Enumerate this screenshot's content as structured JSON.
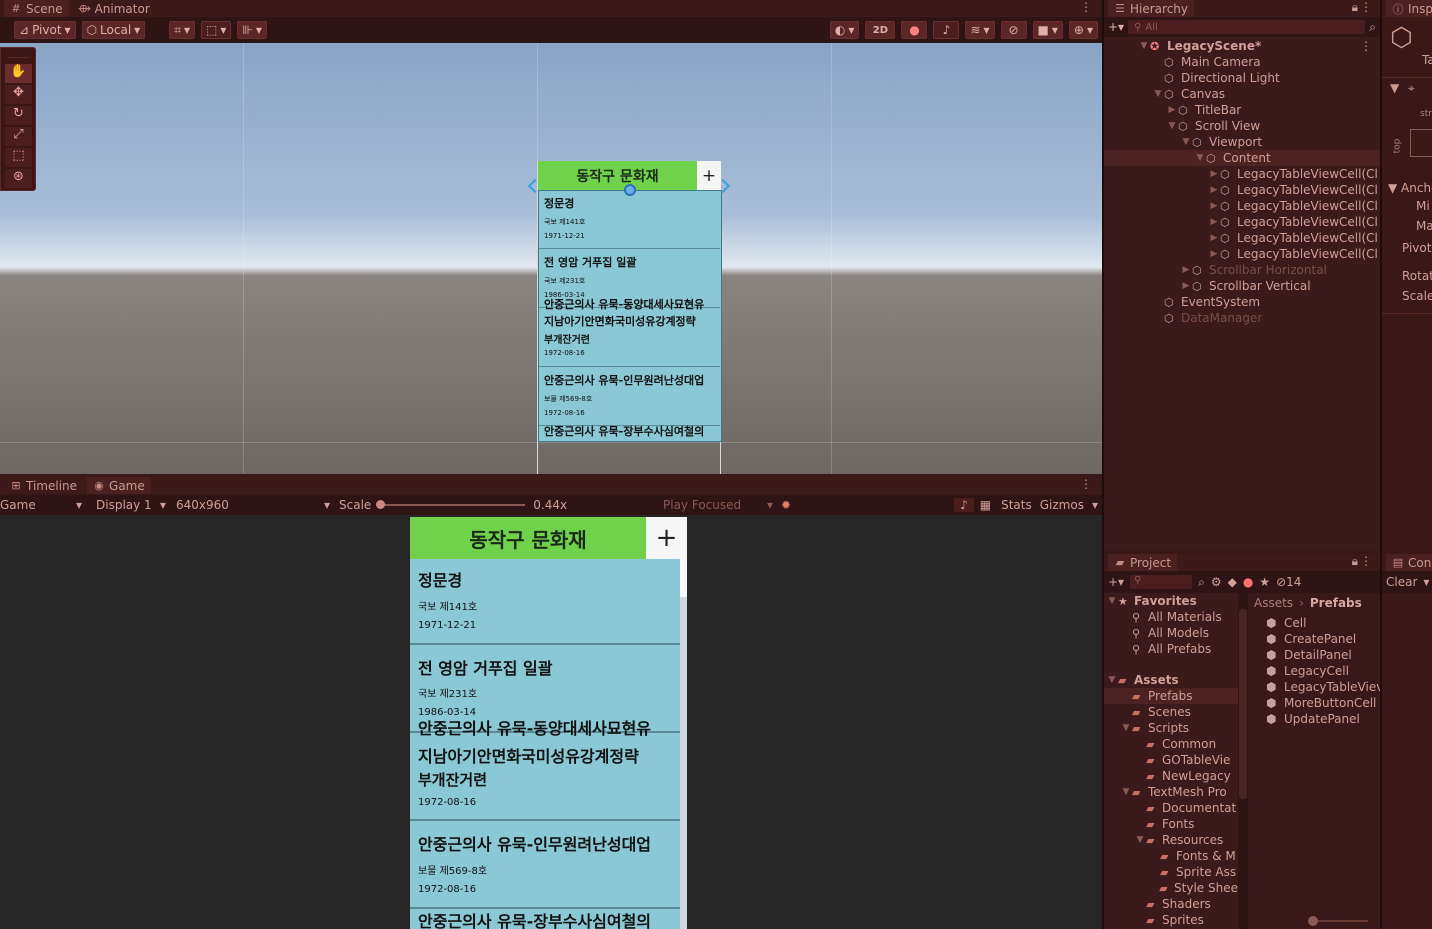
{
  "scene_panel": {
    "tabs": [
      {
        "label": "Scene",
        "icon": "grid-icon"
      },
      {
        "label": "Animator",
        "icon": "animator-icon"
      }
    ],
    "toolbar": {
      "pivot": "Pivot",
      "local": "Local",
      "mode_2d": "2D"
    }
  },
  "scene_view": {
    "title": "동작구 문화재",
    "add": "+",
    "cells": [
      {
        "title": "정문경",
        "sub": "국보 제141호",
        "date": "1971-12-21"
      },
      {
        "title": "전 영암 거푸집 일괄",
        "sub": "국보 제231호",
        "date": "1986-03-14",
        "overflow": "안중근의사 유묵-동양대세사묘현유"
      },
      {
        "title": "지남아기안면화국미성유강계정략",
        "sub": "부개잔거련",
        "date": "1972-08-16"
      },
      {
        "title": "안중근의사 유묵-인무원려난성대업",
        "sub": "보물 제569-8호",
        "date": "1972-08-16"
      },
      {
        "title": "안중근의사 유묵-장부수사심여철의",
        "sub": "",
        "date": ""
      }
    ]
  },
  "game_panel": {
    "tabs": [
      {
        "label": "Timeline",
        "icon": "timeline-icon"
      },
      {
        "label": "Game",
        "icon": "gamepad-icon"
      }
    ],
    "toolbar": {
      "game": "Game",
      "display": "Display 1",
      "resolution": "640x960",
      "scale_label": "Scale",
      "scale_value": "0.44x",
      "play_focused": "Play Focused",
      "stats": "Stats",
      "gizmos": "Gizmos"
    }
  },
  "hierarchy": {
    "tab": "Hierarchy",
    "search_placeholder": "All",
    "items": [
      {
        "label": "LegacyScene*",
        "depth": 0,
        "arrow": "▼",
        "bold": true
      },
      {
        "label": "Main Camera",
        "depth": 1,
        "arrow": ""
      },
      {
        "label": "Directional Light",
        "depth": 1,
        "arrow": ""
      },
      {
        "label": "Canvas",
        "depth": 1,
        "arrow": "▼"
      },
      {
        "label": "TitleBar",
        "depth": 2,
        "arrow": "▶"
      },
      {
        "label": "Scroll View",
        "depth": 2,
        "arrow": "▼"
      },
      {
        "label": "Viewport",
        "depth": 3,
        "arrow": "▼"
      },
      {
        "label": "Content",
        "depth": 4,
        "arrow": "▼",
        "selected": true
      },
      {
        "label": "LegacyTableViewCell(Cl",
        "depth": 5,
        "arrow": "▶"
      },
      {
        "label": "LegacyTableViewCell(Cl",
        "depth": 5,
        "arrow": "▶"
      },
      {
        "label": "LegacyTableViewCell(Cl",
        "depth": 5,
        "arrow": "▶"
      },
      {
        "label": "LegacyTableViewCell(Cl",
        "depth": 5,
        "arrow": "▶"
      },
      {
        "label": "LegacyTableViewCell(Cl",
        "depth": 5,
        "arrow": "▶"
      },
      {
        "label": "LegacyTableViewCell(Cl",
        "depth": 5,
        "arrow": "▶"
      },
      {
        "label": "Scrollbar Horizontal",
        "depth": 3,
        "arrow": "▶",
        "dim": true
      },
      {
        "label": "Scrollbar Vertical",
        "depth": 3,
        "arrow": "▶"
      },
      {
        "label": "EventSystem",
        "depth": 1,
        "arrow": ""
      },
      {
        "label": "DataManager",
        "depth": 1,
        "arrow": "",
        "dim": true
      }
    ]
  },
  "inspector": {
    "tab": "Inspe",
    "labels": [
      "Ta",
      "stret",
      "top",
      "Ancho",
      "Mi",
      "Ma",
      "Pivot",
      "Rotat",
      "Scale"
    ]
  },
  "project": {
    "tab": "Project",
    "hidden_count": "14",
    "breadcrumb": [
      "Assets",
      "Prefabs"
    ],
    "tree": [
      {
        "label": "Favorites",
        "depth": 0,
        "arrow": "▼",
        "kind": "star",
        "bold": true
      },
      {
        "label": "All Materials",
        "depth": 1,
        "arrow": "",
        "kind": "search"
      },
      {
        "label": "All Models",
        "depth": 1,
        "arrow": "",
        "kind": "search"
      },
      {
        "label": "All Prefabs",
        "depth": 1,
        "arrow": "",
        "kind": "search"
      },
      {
        "label": "",
        "depth": 0,
        "arrow": "",
        "kind": "spacer"
      },
      {
        "label": "Assets",
        "depth": 0,
        "arrow": "▼",
        "kind": "folder",
        "bold": true
      },
      {
        "label": "Prefabs",
        "depth": 1,
        "arrow": "",
        "kind": "folder",
        "selected": true
      },
      {
        "label": "Scenes",
        "depth": 1,
        "arrow": "",
        "kind": "folder"
      },
      {
        "label": "Scripts",
        "depth": 1,
        "arrow": "▼",
        "kind": "folder"
      },
      {
        "label": "Common",
        "depth": 2,
        "arrow": "",
        "kind": "folder"
      },
      {
        "label": "GOTableVie",
        "depth": 2,
        "arrow": "",
        "kind": "folder"
      },
      {
        "label": "NewLegacy",
        "depth": 2,
        "arrow": "",
        "kind": "folder"
      },
      {
        "label": "TextMesh Pro",
        "depth": 1,
        "arrow": "▼",
        "kind": "folder"
      },
      {
        "label": "Documentat",
        "depth": 2,
        "arrow": "",
        "kind": "folder"
      },
      {
        "label": "Fonts",
        "depth": 2,
        "arrow": "",
        "kind": "folder"
      },
      {
        "label": "Resources",
        "depth": 2,
        "arrow": "▼",
        "kind": "folder"
      },
      {
        "label": "Fonts & M",
        "depth": 3,
        "arrow": "",
        "kind": "folder"
      },
      {
        "label": "Sprite Ass",
        "depth": 3,
        "arrow": "",
        "kind": "folder"
      },
      {
        "label": "Style Shee",
        "depth": 3,
        "arrow": "",
        "kind": "folder"
      },
      {
        "label": "Shaders",
        "depth": 2,
        "arrow": "",
        "kind": "folder"
      },
      {
        "label": "Sprites",
        "depth": 2,
        "arrow": "",
        "kind": "folder"
      }
    ],
    "files": [
      "Cell",
      "CreatePanel",
      "DetailPanel",
      "LegacyCell",
      "LegacyTableViev",
      "MoreButtonCell",
      "UpdatePanel"
    ]
  },
  "console": {
    "tab": "Cons",
    "clear": "Clear"
  }
}
